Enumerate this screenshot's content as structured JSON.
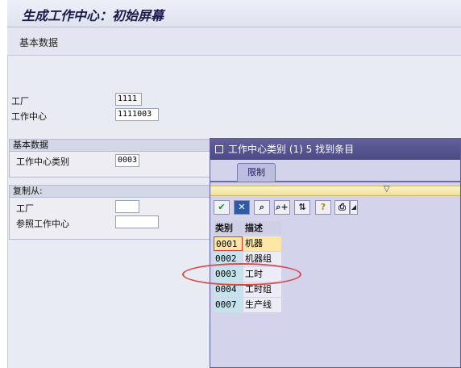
{
  "window": {
    "title": "生成工作中心：初始屏幕"
  },
  "toolbar": {
    "basic_data_label": "基本数据"
  },
  "header_fields": {
    "plant": {
      "label": "工厂",
      "value": "1111"
    },
    "work_center": {
      "label": "工作中心",
      "value": "1111003"
    }
  },
  "basic_data_group": {
    "title": "基本数据",
    "category_label": "工作中心类别",
    "category_value": "0003"
  },
  "copy_from_group": {
    "title": "复制从:",
    "plant_label": "工厂",
    "plant_value": "",
    "ref_work_center_label": "参照工作中心",
    "ref_work_center_value": ""
  },
  "popup": {
    "title": "工作中心类别 (1)    5 找到条目",
    "tab_label": "限制",
    "toolbar_icons": [
      "check-icon",
      "cancel-icon",
      "find-icon",
      "find-next-icon",
      "sort-icon",
      "help-icon",
      "print-icon",
      "dropdown-icon"
    ],
    "columns": [
      "类别",
      "描述"
    ],
    "rows": [
      {
        "code": "0001",
        "desc": "机器"
      },
      {
        "code": "0002",
        "desc": "机器组"
      },
      {
        "code": "0003",
        "desc": "工时"
      },
      {
        "code": "0004",
        "desc": "工时组"
      },
      {
        "code": "0007",
        "desc": "生产线"
      }
    ],
    "selected_row": "0001"
  },
  "colors": {
    "popup_title_bg": "#5b5a94",
    "popup_bg": "#d3d3ec",
    "annotation": "#d84a4a",
    "selected_row_bg": "#fde6a6"
  }
}
